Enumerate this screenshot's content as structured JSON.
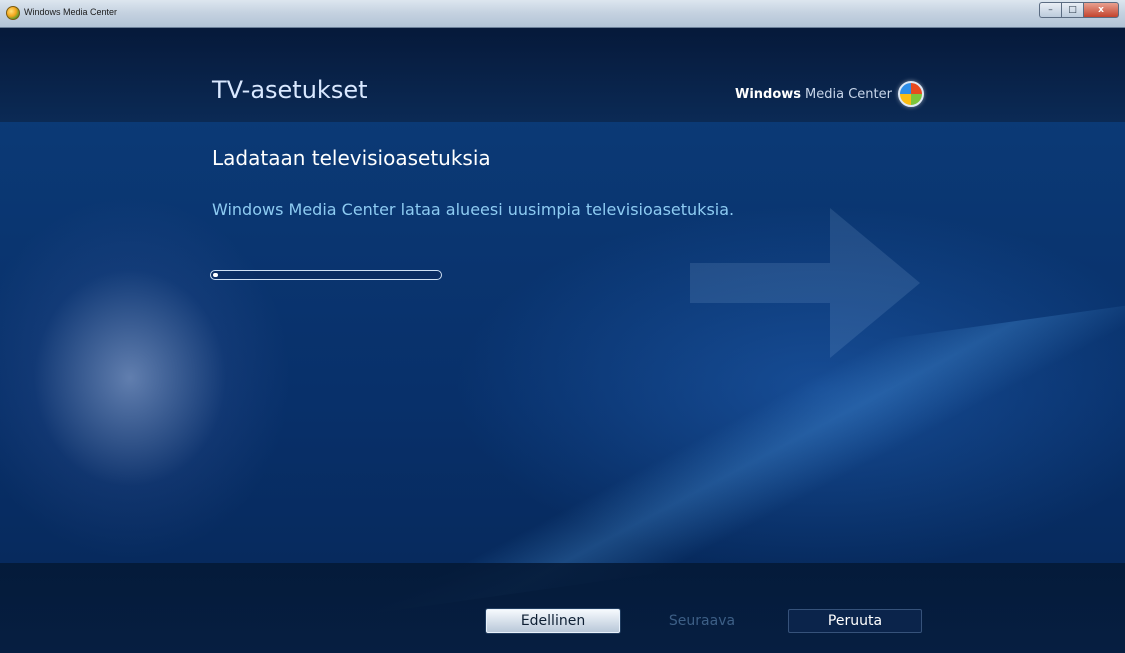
{
  "window": {
    "title": "Windows Media Center",
    "controls": {
      "minimize": "–",
      "maximize": "□",
      "close": "x"
    }
  },
  "header": {
    "section_title": "TV-asetukset",
    "brand_bold": "Windows",
    "brand_rest": "Media Center",
    "brand_icon": "windows-orb-icon"
  },
  "main": {
    "heading": "Ladataan televisioasetuksia",
    "description": "Windows Media Center lataa alueesi uusimpia televisioasetuksia.",
    "progress_fraction": 0.02
  },
  "footer": {
    "back_label": "Edellinen",
    "next_label": "Seuraava",
    "cancel_label": "Peruuta"
  },
  "colors": {
    "accent_text": "#8dcbf2",
    "background": "#0a3570",
    "disabled_text": "#3d5f86"
  }
}
